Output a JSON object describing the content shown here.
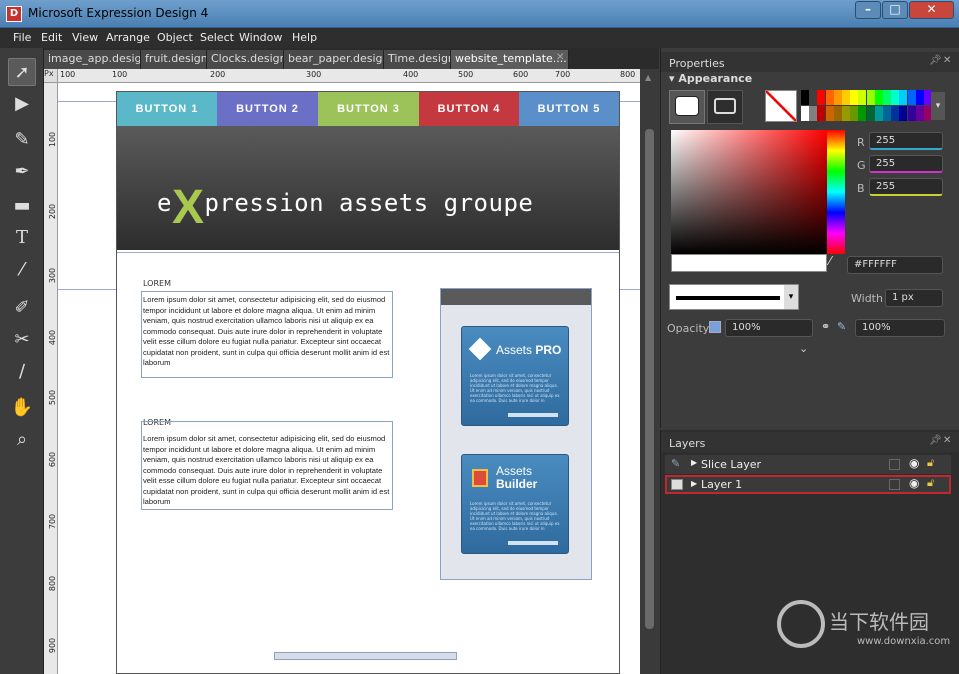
{
  "window": {
    "title": "Microsoft Expression Design 4",
    "icon_letter": "D"
  },
  "menu": [
    "File",
    "Edit",
    "View",
    "Arrange",
    "Object",
    "Select",
    "Window",
    "Help"
  ],
  "tabs": [
    {
      "label": "image_app.design",
      "active": false
    },
    {
      "label": "fruit.design",
      "active": false
    },
    {
      "label": "Clocks.design",
      "active": false
    },
    {
      "label": "bear_paper.design",
      "active": false
    },
    {
      "label": "Time.design",
      "active": false
    },
    {
      "label": "website_template....",
      "active": true
    }
  ],
  "ruler": {
    "unit": "Px",
    "top_ticks": [
      "100",
      "100",
      "200",
      "300",
      "400",
      "500",
      "600",
      "700",
      "800"
    ],
    "left_ticks": [
      "100",
      "200",
      "300",
      "400",
      "500",
      "600",
      "700",
      "800",
      "900"
    ]
  },
  "tools": [
    "selection-arrow",
    "direct-select",
    "brush",
    "pen",
    "rectangle",
    "text",
    "eyedropper-stroke",
    "eraser",
    "scissors",
    "eyedropper",
    "hand",
    "zoom"
  ],
  "design": {
    "nav_buttons": [
      {
        "label": "BUTTON 1",
        "color": "#5bb8c9"
      },
      {
        "label": "BUTTON 2",
        "color": "#6b6fc6"
      },
      {
        "label": "BUTTON 3",
        "color": "#9cc35a"
      },
      {
        "label": "BUTTON 4",
        "color": "#c4393f"
      },
      {
        "label": "BUTTON 5",
        "color": "#5b8fc9"
      }
    ],
    "brand_pre": "e",
    "brand_x": "X",
    "brand_post": "pression assets groupe",
    "section1_label": "LOREM",
    "section2_label": "LOREM",
    "paragraph": "Lorem ipsum dolor sit amet, consectetur adipisicing elit, sed do eiusmod tempor incididunt ut labore et dolore magna aliqua. Ut enim ad minim veniam, quis nostrud exercitation ullamco laboris nisi ut aliquip ex ea commodo consequat. Duis aute irure dolor in reprehenderit in voluptate velit esse cillum dolore eu fugiat nulla pariatur. Excepteur sint occaecat cupidatat non proident, sunt in culpa qui officia deserunt mollit anim id est laborum",
    "card1_title_a": "Assets ",
    "card1_title_b": "PRO",
    "card2_title_a": "Assets",
    "card2_title_b": "Builder",
    "card_text": "Lorem ipsum dolor sit amet, consectetur adipisicing elit, sed do eiusmod tempor incididunt ut labore et dolore magna aliqua. Ut enim ad minim veniam, quis nostrud exercitation ullamco laboris nisi ut aliquip ex ea commodo. Duis aute irure dolor in reprehenderit"
  },
  "properties": {
    "title": "Properties",
    "appearance": "Appearance",
    "r_label": "R",
    "g_label": "G",
    "b_label": "B",
    "r": "255",
    "g": "255",
    "b": "255",
    "hex": "#FFFFFF",
    "width_label": "Width",
    "width_value": "1 px",
    "opacity_label": "Opacity",
    "opacity_value": "100%",
    "opacity_value2": "100%",
    "palette": [
      "#000000",
      "#404040",
      "#ff0000",
      "#ff6600",
      "#ff9900",
      "#ffcc00",
      "#ffff00",
      "#ccff00",
      "#99ff00",
      "#00ff00",
      "#00ff66",
      "#00ffcc",
      "#00ccff",
      "#0066ff",
      "#0000ff",
      "#6600ff",
      "#ffffff",
      "#808080",
      "#c00000",
      "#cc6600",
      "#996600",
      "#999900",
      "#669900",
      "#009900",
      "#006633",
      "#009999",
      "#006699",
      "#003399",
      "#000099",
      "#330099",
      "#660099",
      "#990066"
    ]
  },
  "layers": {
    "title": "Layers",
    "items": [
      {
        "name": "Slice Layer",
        "selected": false
      },
      {
        "name": "Layer 1",
        "selected": true
      }
    ]
  },
  "watermark": {
    "cn": "当下软件园",
    "url": "www.downxia.com"
  }
}
